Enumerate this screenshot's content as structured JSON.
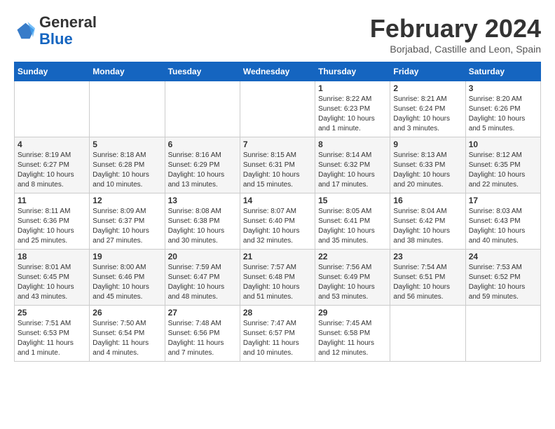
{
  "header": {
    "logo_general": "General",
    "logo_blue": "Blue",
    "month_title": "February 2024",
    "subtitle": "Borjabad, Castille and Leon, Spain"
  },
  "days_of_week": [
    "Sunday",
    "Monday",
    "Tuesday",
    "Wednesday",
    "Thursday",
    "Friday",
    "Saturday"
  ],
  "weeks": [
    [
      {
        "day": "",
        "info": ""
      },
      {
        "day": "",
        "info": ""
      },
      {
        "day": "",
        "info": ""
      },
      {
        "day": "",
        "info": ""
      },
      {
        "day": "1",
        "info": "Sunrise: 8:22 AM\nSunset: 6:23 PM\nDaylight: 10 hours and 1 minute."
      },
      {
        "day": "2",
        "info": "Sunrise: 8:21 AM\nSunset: 6:24 PM\nDaylight: 10 hours and 3 minutes."
      },
      {
        "day": "3",
        "info": "Sunrise: 8:20 AM\nSunset: 6:26 PM\nDaylight: 10 hours and 5 minutes."
      }
    ],
    [
      {
        "day": "4",
        "info": "Sunrise: 8:19 AM\nSunset: 6:27 PM\nDaylight: 10 hours and 8 minutes."
      },
      {
        "day": "5",
        "info": "Sunrise: 8:18 AM\nSunset: 6:28 PM\nDaylight: 10 hours and 10 minutes."
      },
      {
        "day": "6",
        "info": "Sunrise: 8:16 AM\nSunset: 6:29 PM\nDaylight: 10 hours and 13 minutes."
      },
      {
        "day": "7",
        "info": "Sunrise: 8:15 AM\nSunset: 6:31 PM\nDaylight: 10 hours and 15 minutes."
      },
      {
        "day": "8",
        "info": "Sunrise: 8:14 AM\nSunset: 6:32 PM\nDaylight: 10 hours and 17 minutes."
      },
      {
        "day": "9",
        "info": "Sunrise: 8:13 AM\nSunset: 6:33 PM\nDaylight: 10 hours and 20 minutes."
      },
      {
        "day": "10",
        "info": "Sunrise: 8:12 AM\nSunset: 6:35 PM\nDaylight: 10 hours and 22 minutes."
      }
    ],
    [
      {
        "day": "11",
        "info": "Sunrise: 8:11 AM\nSunset: 6:36 PM\nDaylight: 10 hours and 25 minutes."
      },
      {
        "day": "12",
        "info": "Sunrise: 8:09 AM\nSunset: 6:37 PM\nDaylight: 10 hours and 27 minutes."
      },
      {
        "day": "13",
        "info": "Sunrise: 8:08 AM\nSunset: 6:38 PM\nDaylight: 10 hours and 30 minutes."
      },
      {
        "day": "14",
        "info": "Sunrise: 8:07 AM\nSunset: 6:40 PM\nDaylight: 10 hours and 32 minutes."
      },
      {
        "day": "15",
        "info": "Sunrise: 8:05 AM\nSunset: 6:41 PM\nDaylight: 10 hours and 35 minutes."
      },
      {
        "day": "16",
        "info": "Sunrise: 8:04 AM\nSunset: 6:42 PM\nDaylight: 10 hours and 38 minutes."
      },
      {
        "day": "17",
        "info": "Sunrise: 8:03 AM\nSunset: 6:43 PM\nDaylight: 10 hours and 40 minutes."
      }
    ],
    [
      {
        "day": "18",
        "info": "Sunrise: 8:01 AM\nSunset: 6:45 PM\nDaylight: 10 hours and 43 minutes."
      },
      {
        "day": "19",
        "info": "Sunrise: 8:00 AM\nSunset: 6:46 PM\nDaylight: 10 hours and 45 minutes."
      },
      {
        "day": "20",
        "info": "Sunrise: 7:59 AM\nSunset: 6:47 PM\nDaylight: 10 hours and 48 minutes."
      },
      {
        "day": "21",
        "info": "Sunrise: 7:57 AM\nSunset: 6:48 PM\nDaylight: 10 hours and 51 minutes."
      },
      {
        "day": "22",
        "info": "Sunrise: 7:56 AM\nSunset: 6:49 PM\nDaylight: 10 hours and 53 minutes."
      },
      {
        "day": "23",
        "info": "Sunrise: 7:54 AM\nSunset: 6:51 PM\nDaylight: 10 hours and 56 minutes."
      },
      {
        "day": "24",
        "info": "Sunrise: 7:53 AM\nSunset: 6:52 PM\nDaylight: 10 hours and 59 minutes."
      }
    ],
    [
      {
        "day": "25",
        "info": "Sunrise: 7:51 AM\nSunset: 6:53 PM\nDaylight: 11 hours and 1 minute."
      },
      {
        "day": "26",
        "info": "Sunrise: 7:50 AM\nSunset: 6:54 PM\nDaylight: 11 hours and 4 minutes."
      },
      {
        "day": "27",
        "info": "Sunrise: 7:48 AM\nSunset: 6:56 PM\nDaylight: 11 hours and 7 minutes."
      },
      {
        "day": "28",
        "info": "Sunrise: 7:47 AM\nSunset: 6:57 PM\nDaylight: 11 hours and 10 minutes."
      },
      {
        "day": "29",
        "info": "Sunrise: 7:45 AM\nSunset: 6:58 PM\nDaylight: 11 hours and 12 minutes."
      },
      {
        "day": "",
        "info": ""
      },
      {
        "day": "",
        "info": ""
      }
    ]
  ]
}
